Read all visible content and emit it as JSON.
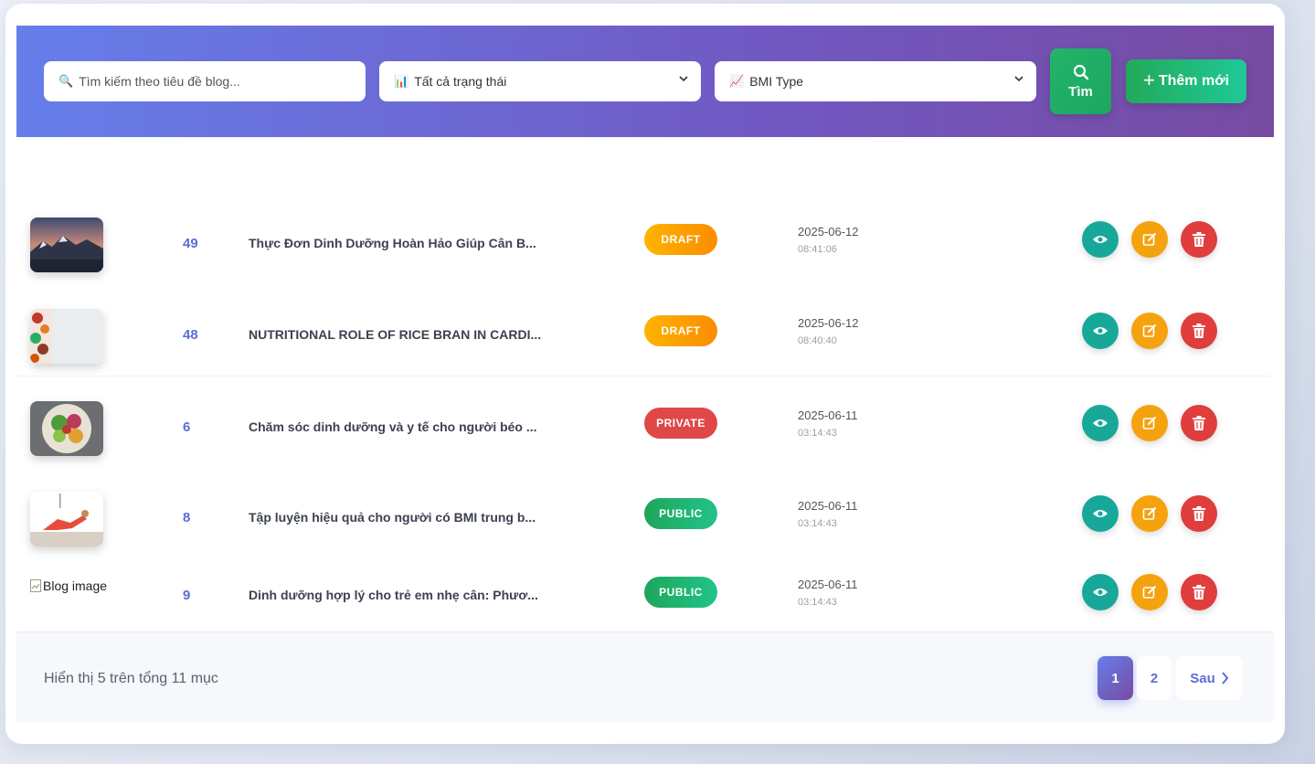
{
  "filters": {
    "search_placeholder": "Tìm kiếm theo tiêu đề blog...",
    "status_select_value": "Tất cả trạng thái",
    "bmi_select_value": "BMI Type",
    "search_button_label": "Tìm",
    "add_button_label": "Thêm mới"
  },
  "rows": [
    {
      "id": "49",
      "title": "Thực Đơn Dinh Dưỡng Hoàn Hảo Giúp Cân B...",
      "status": "DRAFT",
      "date": "2025-06-12",
      "time": "08:41:06",
      "image": "mountain"
    },
    {
      "id": "48",
      "title": "NUTRITIONAL ROLE OF RICE BRAN IN CARDI...",
      "status": "DRAFT",
      "date": "2025-06-12",
      "time": "08:40:40",
      "image": "food"
    },
    {
      "id": "6",
      "title": "Chăm sóc dinh dưỡng và y tế cho người béo ...",
      "status": "PRIVATE",
      "date": "2025-06-11",
      "time": "03:14:43",
      "image": "salad"
    },
    {
      "id": "8",
      "title": "Tập luyện hiệu quả cho người có BMI trung b...",
      "status": "PUBLIC",
      "date": "2025-06-11",
      "time": "03:14:43",
      "image": "workout"
    },
    {
      "id": "9",
      "title": "Dinh dưỡng hợp lý cho trẻ em nhẹ cân: Phươ...",
      "status": "PUBLIC",
      "date": "2025-06-11",
      "time": "03:14:43",
      "image_alt": "Blog image"
    }
  ],
  "footer": {
    "summary": "Hiển thị 5 trên tổng 11 mục",
    "pages": [
      "1",
      "2"
    ],
    "current_page": "1",
    "next_label": "Sau"
  },
  "colors": {
    "header_gradient_start": "#667eea",
    "header_gradient_end": "#764ba2",
    "draft": "#fb8c00",
    "private": "#e04848",
    "public": "#1ea65a",
    "view": "#17a89a",
    "edit": "#f5a20f",
    "delete": "#e03d3d"
  }
}
